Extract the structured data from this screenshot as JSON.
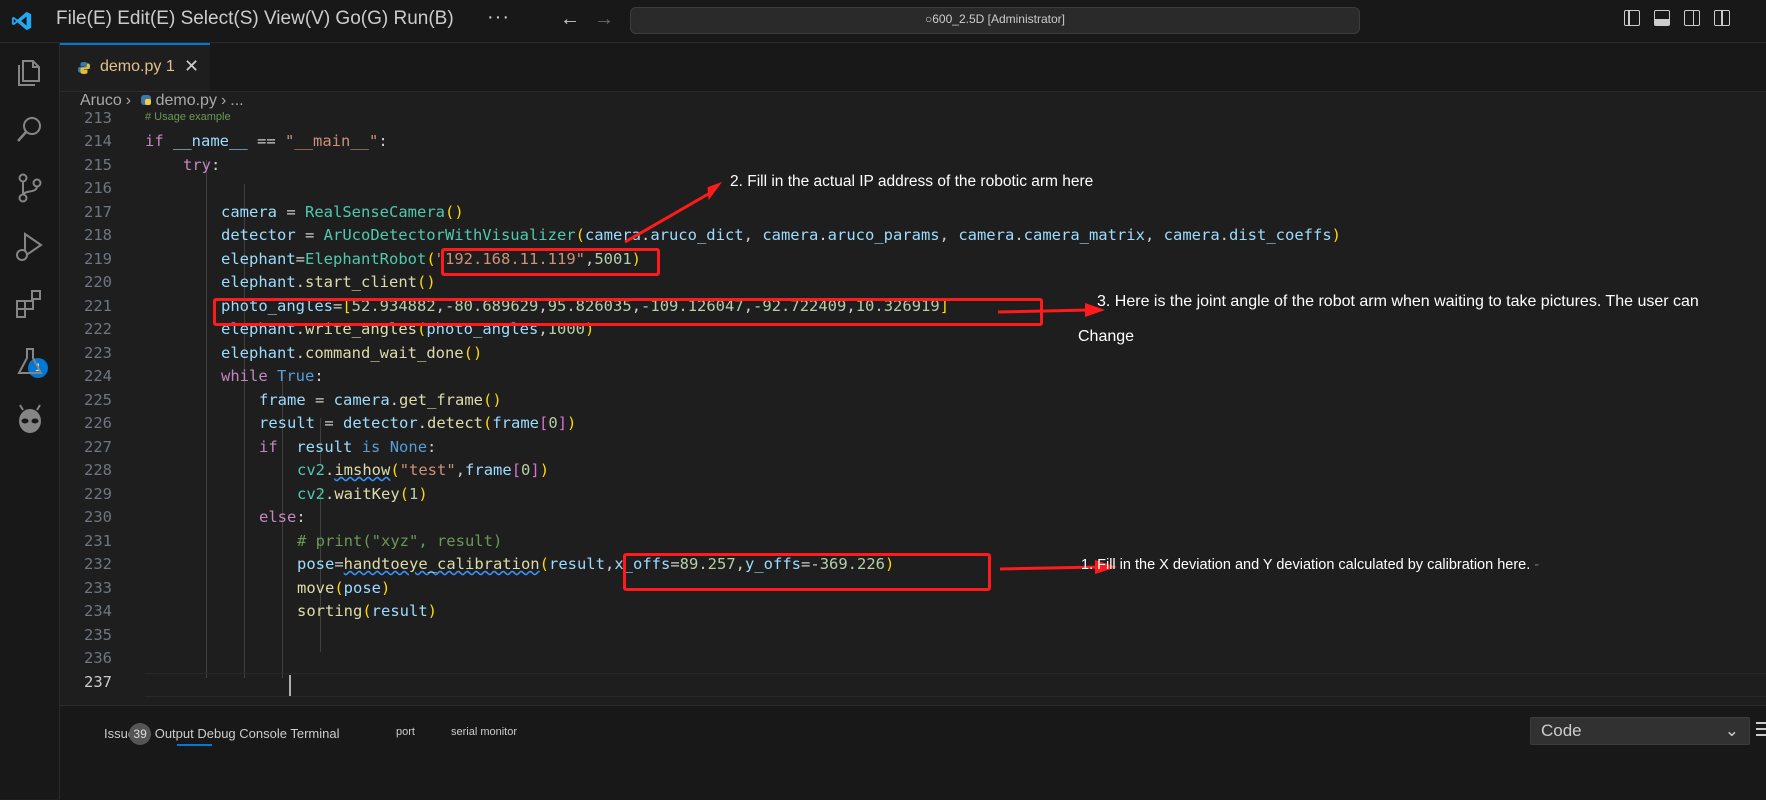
{
  "titlebar": {
    "menu": "File(E) Edit(E) Select(S) View(V) Go(G) Run(B)",
    "more": "···",
    "search_text": "○600_2.5D [Administrator]"
  },
  "activitybar": {
    "extensions_badge": "1"
  },
  "tab": {
    "filename": "demo.py",
    "problem_count": "1",
    "close": "✕"
  },
  "breadcrumb": {
    "folder": "Aruco",
    "sep1": "›",
    "file": "demo.py",
    "sep2": "›",
    "more": "..."
  },
  "code": {
    "lines": [
      {
        "n": "213",
        "text": "# Usage example"
      },
      {
        "n": "214",
        "text": "if __name__ == \"__main__\":"
      },
      {
        "n": "215",
        "text": "try:"
      },
      {
        "n": "216",
        "text": ""
      },
      {
        "n": "217",
        "text": "camera = RealSenseCamera()"
      },
      {
        "n": "218",
        "text": "detector = ArUcoDetectorWithVisualizer(camera.aruco_dict, camera.aruco_params, camera.camera_matrix, camera.dist_coeffs)"
      },
      {
        "n": "219",
        "text": "elephant=ElephantRobot(\"192.168.11.119\",5001)"
      },
      {
        "n": "220",
        "text": "elephant.start_client()"
      },
      {
        "n": "221",
        "text": "photo_angles=[52.934882,-80.689629,95.826035,-109.126047,-92.722409,10.326919]"
      },
      {
        "n": "222",
        "text": "elephant.write_angles(photo_angles,1000)"
      },
      {
        "n": "223",
        "text": "elephant.command_wait_done()"
      },
      {
        "n": "224",
        "text": "while True:"
      },
      {
        "n": "225",
        "text": "frame = camera.get_frame()"
      },
      {
        "n": "226",
        "text": "result = detector.detect(frame[0])"
      },
      {
        "n": "227",
        "text": "if  result is None:"
      },
      {
        "n": "228",
        "text": "cv2.imshow(\"test\",frame[0])"
      },
      {
        "n": "229",
        "text": "cv2.waitKey(1)"
      },
      {
        "n": "230",
        "text": "else:"
      },
      {
        "n": "231",
        "text": "# print(\"xyz\", result)"
      },
      {
        "n": "232",
        "text": "pose=handtoeye_calibration(result,x_offs=89.257,y_offs=-369.226)"
      },
      {
        "n": "233",
        "text": "move(pose)"
      },
      {
        "n": "234",
        "text": "sorting(result)"
      },
      {
        "n": "235",
        "text": ""
      },
      {
        "n": "236",
        "text": ""
      },
      {
        "n": "237",
        "text": ""
      }
    ]
  },
  "annotations": {
    "note1": "1. Fill in the X deviation and Y deviation calculated by calibration here.",
    "note1_tail": "-",
    "note2": "2. Fill in the actual IP address of the robotic arm here",
    "note3_line1": "3. Here is the joint angle of the robot arm when waiting to take pictures. The user can",
    "note3_line2": "Change"
  },
  "panel": {
    "tabs_text": "Issue",
    "issue_count": "39",
    "tabs_rest": "Output Debug Console Terminal",
    "port": "port",
    "serial_monitor": "serial monitor",
    "select_value": "Code",
    "select_chevron": "⌄"
  },
  "colors": {
    "accent": "#0078d4",
    "annotation": "#ff1b1b",
    "background": "#1e1e1e"
  }
}
